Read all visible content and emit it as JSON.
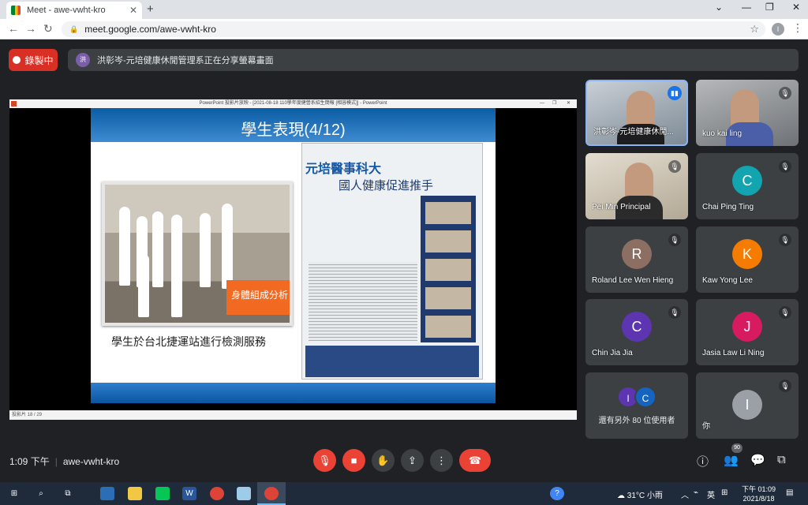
{
  "browser": {
    "tab_title": "Meet - awe-vwht-kro",
    "tab_close": "✕",
    "new_tab": "+",
    "url": "meet.google.com/awe-vwht-kro",
    "profile_initial": "I"
  },
  "meet": {
    "recording_label": "錄製中",
    "presenter_initial": "洪",
    "presenting_text": "洪彰岑-元培健康休閒管理系正在分享螢幕畫面",
    "time": "1:09 下午",
    "meeting_code": "awe-vwht-kro",
    "people_count": "90"
  },
  "presentation": {
    "window_title": "PowerPoint 投影片放映 - [2021-08-18 110學年度健營系招生簡報 [相容模式]] - PowerPoint",
    "slide_title": "學生表現(4/12)",
    "photo_sign": "身體組成分析",
    "caption": "學生於台北捷運站進行檢測服務",
    "newspaper_masthead": "元培醫事科大",
    "newspaper_headline": "國人健康促進推手",
    "status": "投影片 18 / 29"
  },
  "participants": [
    {
      "name": "洪彰岑-元培健康休閒...",
      "type": "video",
      "speaking": true
    },
    {
      "name": "kuo kai ling",
      "type": "video",
      "muted": true
    },
    {
      "name": "Pei Min Principal",
      "type": "video",
      "muted": true
    },
    {
      "name": "Chai Ping Ting",
      "initial": "C",
      "color": "#12a4af",
      "muted": true
    },
    {
      "name": "Roland Lee Wen Hieng",
      "initial": "R",
      "color": "#8d6e63",
      "muted": true
    },
    {
      "name": "Kaw Yong Lee",
      "initial": "K",
      "color": "#f57c00",
      "muted": true
    },
    {
      "name": "Chin Jia Jia",
      "initial": "C",
      "color": "#5e35b1",
      "muted": true
    },
    {
      "name": "Jasia Law Li Ning",
      "initial": "J",
      "color": "#d81b60",
      "muted": true
    },
    {
      "name": "還有另外 80 位使用者",
      "initials": [
        "I",
        "C"
      ]
    },
    {
      "name": "你",
      "initial": "I",
      "color": "#9aa0a6",
      "muted": true
    }
  ],
  "taskbar": {
    "weather": "31°C 小雨",
    "ime": "英",
    "clock_time": "下午 01:09",
    "clock_date": "2021/8/18"
  }
}
